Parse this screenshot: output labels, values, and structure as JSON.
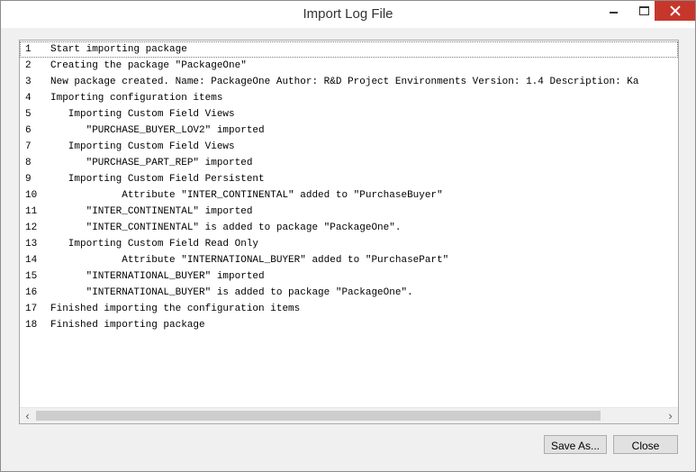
{
  "window": {
    "title": "Import Log File",
    "close_color": "#c7362b"
  },
  "log": {
    "lines": [
      {
        "num": "1",
        "text": "Start importing package"
      },
      {
        "num": "2",
        "text": "Creating the package \"PackageOne\""
      },
      {
        "num": "3",
        "text": "New package created. Name: PackageOne Author: R&D Project Environments Version: 1.4 Description: Ka"
      },
      {
        "num": "4",
        "text": "Importing configuration items"
      },
      {
        "num": "5",
        "text": "   Importing Custom Field Views"
      },
      {
        "num": "6",
        "text": "      \"PURCHASE_BUYER_LOV2\" imported"
      },
      {
        "num": "7",
        "text": "   Importing Custom Field Views"
      },
      {
        "num": "8",
        "text": "      \"PURCHASE_PART_REP\" imported"
      },
      {
        "num": "9",
        "text": "   Importing Custom Field Persistent"
      },
      {
        "num": "10",
        "text": "            Attribute \"INTER_CONTINENTAL\" added to \"PurchaseBuyer\""
      },
      {
        "num": "11",
        "text": "      \"INTER_CONTINENTAL\" imported"
      },
      {
        "num": "12",
        "text": "      \"INTER_CONTINENTAL\" is added to package \"PackageOne\"."
      },
      {
        "num": "13",
        "text": "   Importing Custom Field Read Only"
      },
      {
        "num": "14",
        "text": "            Attribute \"INTERNATIONAL_BUYER\" added to \"PurchasePart\""
      },
      {
        "num": "15",
        "text": "      \"INTERNATIONAL_BUYER\" imported"
      },
      {
        "num": "16",
        "text": "      \"INTERNATIONAL_BUYER\" is added to package \"PackageOne\"."
      },
      {
        "num": "17",
        "text": "Finished importing the configuration items"
      },
      {
        "num": "18",
        "text": "Finished importing package"
      }
    ]
  },
  "buttons": {
    "save_as": "Save As...",
    "close": "Close"
  },
  "icons": {
    "minimize": "minimize-icon",
    "maximize": "maximize-icon",
    "close": "close-icon",
    "scroll_left": "chevron-left-icon",
    "scroll_right": "chevron-right-icon"
  }
}
